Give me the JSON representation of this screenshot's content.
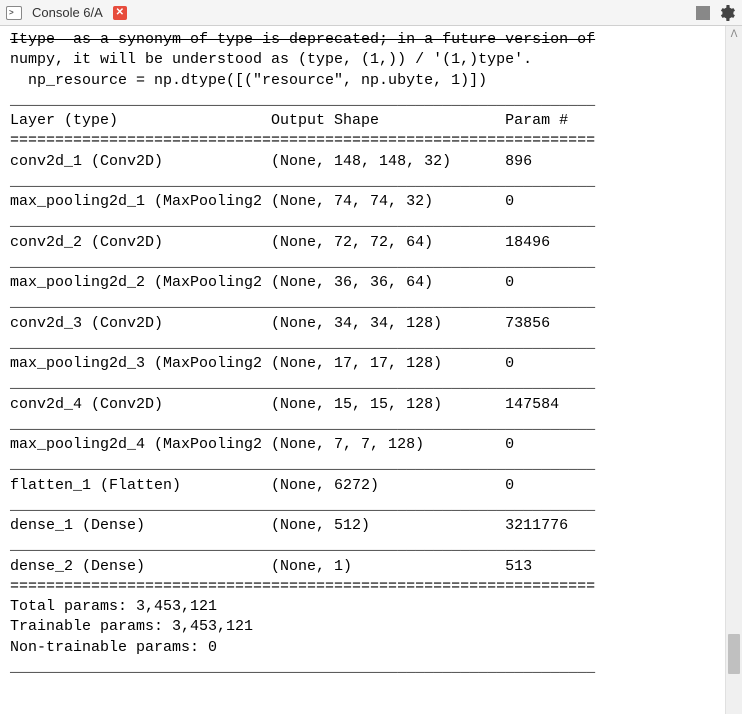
{
  "titlebar": {
    "tab_label": "Console 6/A",
    "close_symbol": "✕",
    "scroll_up_symbol": "ᐱ"
  },
  "console": {
    "line0": "Itype  as a synonym of type is deprecated; in a future version of",
    "line1": "numpy, it will be understood as (type, (1,)) / '(1,)type'.",
    "line2": "  np_resource = np.dtype([(\"resource\", np.ubyte, 1)])",
    "empty": "",
    "sep_thick": "=================================================================",
    "sep_thin": "_________________________________________________________________",
    "header": "Layer (type)                 Output Shape              Param #   ",
    "rows": [
      "conv2d_1 (Conv2D)            (None, 148, 148, 32)      896       ",
      "max_pooling2d_1 (MaxPooling2 (None, 74, 74, 32)        0         ",
      "conv2d_2 (Conv2D)            (None, 72, 72, 64)        18496     ",
      "max_pooling2d_2 (MaxPooling2 (None, 36, 36, 64)        0         ",
      "conv2d_3 (Conv2D)            (None, 34, 34, 128)       73856     ",
      "max_pooling2d_3 (MaxPooling2 (None, 17, 17, 128)       0         ",
      "conv2d_4 (Conv2D)            (None, 15, 15, 128)       147584    ",
      "max_pooling2d_4 (MaxPooling2 (None, 7, 7, 128)         0         ",
      "flatten_1 (Flatten)          (None, 6272)              0         ",
      "dense_1 (Dense)              (None, 512)               3211776   ",
      "dense_2 (Dense)              (None, 1)                 513       "
    ],
    "total": "Total params: 3,453,121",
    "trainable": "Trainable params: 3,453,121",
    "nontrainable": "Non-trainable params: 0"
  },
  "chart_data": {
    "type": "table",
    "title": "Keras Model Summary",
    "columns": [
      "Layer (type)",
      "Output Shape",
      "Param #"
    ],
    "rows": [
      [
        "conv2d_1 (Conv2D)",
        "(None, 148, 148, 32)",
        896
      ],
      [
        "max_pooling2d_1 (MaxPooling2",
        "(None, 74, 74, 32)",
        0
      ],
      [
        "conv2d_2 (Conv2D)",
        "(None, 72, 72, 64)",
        18496
      ],
      [
        "max_pooling2d_2 (MaxPooling2",
        "(None, 36, 36, 64)",
        0
      ],
      [
        "conv2d_3 (Conv2D)",
        "(None, 34, 34, 128)",
        73856
      ],
      [
        "max_pooling2d_3 (MaxPooling2",
        "(None, 17, 17, 128)",
        0
      ],
      [
        "conv2d_4 (Conv2D)",
        "(None, 15, 15, 128)",
        147584
      ],
      [
        "max_pooling2d_4 (MaxPooling2",
        "(None, 7, 7, 128)",
        0
      ],
      [
        "flatten_1 (Flatten)",
        "(None, 6272)",
        0
      ],
      [
        "dense_1 (Dense)",
        "(None, 512)",
        3211776
      ],
      [
        "dense_2 (Dense)",
        "(None, 1)",
        513
      ]
    ],
    "totals": {
      "total_params": 3453121,
      "trainable_params": 3453121,
      "non_trainable_params": 0
    }
  }
}
